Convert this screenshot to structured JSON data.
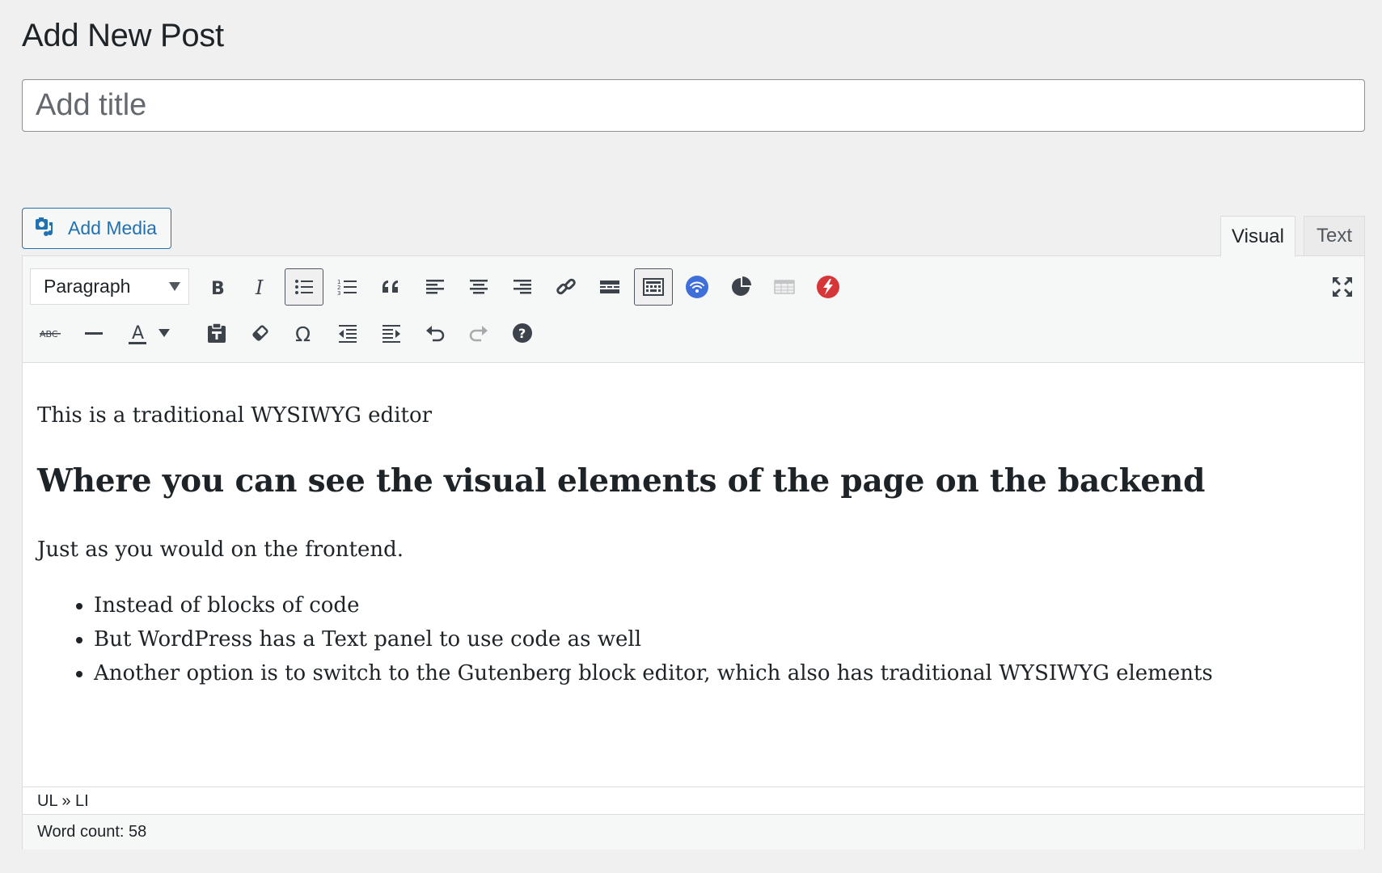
{
  "page": {
    "title": "Add New Post"
  },
  "title_field": {
    "placeholder": "Add title",
    "value": ""
  },
  "media": {
    "add_media_label": "Add Media"
  },
  "tabs": [
    {
      "label": "Visual",
      "active": true
    },
    {
      "label": "Text",
      "active": false
    }
  ],
  "toolbar": {
    "format_select": {
      "value": "Paragraph"
    },
    "row1_icons": [
      "bold-icon",
      "italic-icon",
      "bulleted-list-icon",
      "numbered-list-icon",
      "blockquote-icon",
      "align-left-icon",
      "align-center-icon",
      "align-right-icon",
      "link-icon",
      "read-more-icon",
      "toolbar-toggle-icon",
      "wifi-plugin-icon",
      "pie-chart-plugin-icon",
      "table-plugin-icon",
      "zap-plugin-icon",
      "fullscreen-icon"
    ],
    "row2_icons": [
      "strikethrough-icon",
      "horizontal-line-icon",
      "text-color-icon",
      "paste-as-text-icon",
      "clear-formatting-icon",
      "special-character-icon",
      "decrease-indent-icon",
      "increase-indent-icon",
      "undo-icon",
      "redo-icon",
      "help-icon"
    ],
    "colors": {
      "wifi": "#3f6fd8",
      "zap": "#d63638",
      "text": "#3c434a"
    }
  },
  "content": {
    "paragraph1": "This is a traditional WYSIWYG editor",
    "heading": "Where you can see the visual elements of the page on the backend",
    "paragraph2": "Just as you would on the frontend.",
    "list": [
      "Instead of blocks of code",
      "But WordPress has a Text panel to use code as well",
      "Another option is to switch to the Gutenberg block editor, which also has traditional WYSIWYG elements"
    ]
  },
  "status": {
    "path": "UL » LI",
    "word_count": "Word count: 58"
  }
}
